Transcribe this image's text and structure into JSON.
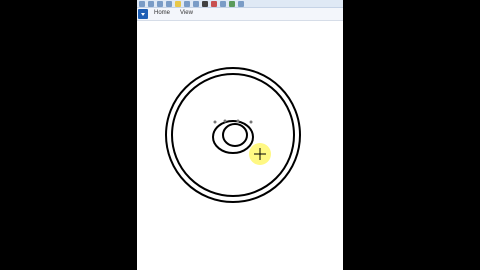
{
  "menu": {
    "home_label": "Home",
    "view_label": "View"
  },
  "toolbar_icons": [
    "save-icon",
    "undo-icon",
    "redo-icon",
    "select-icon",
    "crop-icon",
    "pencil-icon",
    "fill-icon",
    "text-icon",
    "brush-icon",
    "shapes-icon",
    "line-icon",
    "color-icon"
  ],
  "colors": {
    "ribbon_bg": "#dfe9f5",
    "file_tab": "#1e5fb5",
    "stroke": "#000000",
    "cursor_highlight": "#fff55a"
  }
}
